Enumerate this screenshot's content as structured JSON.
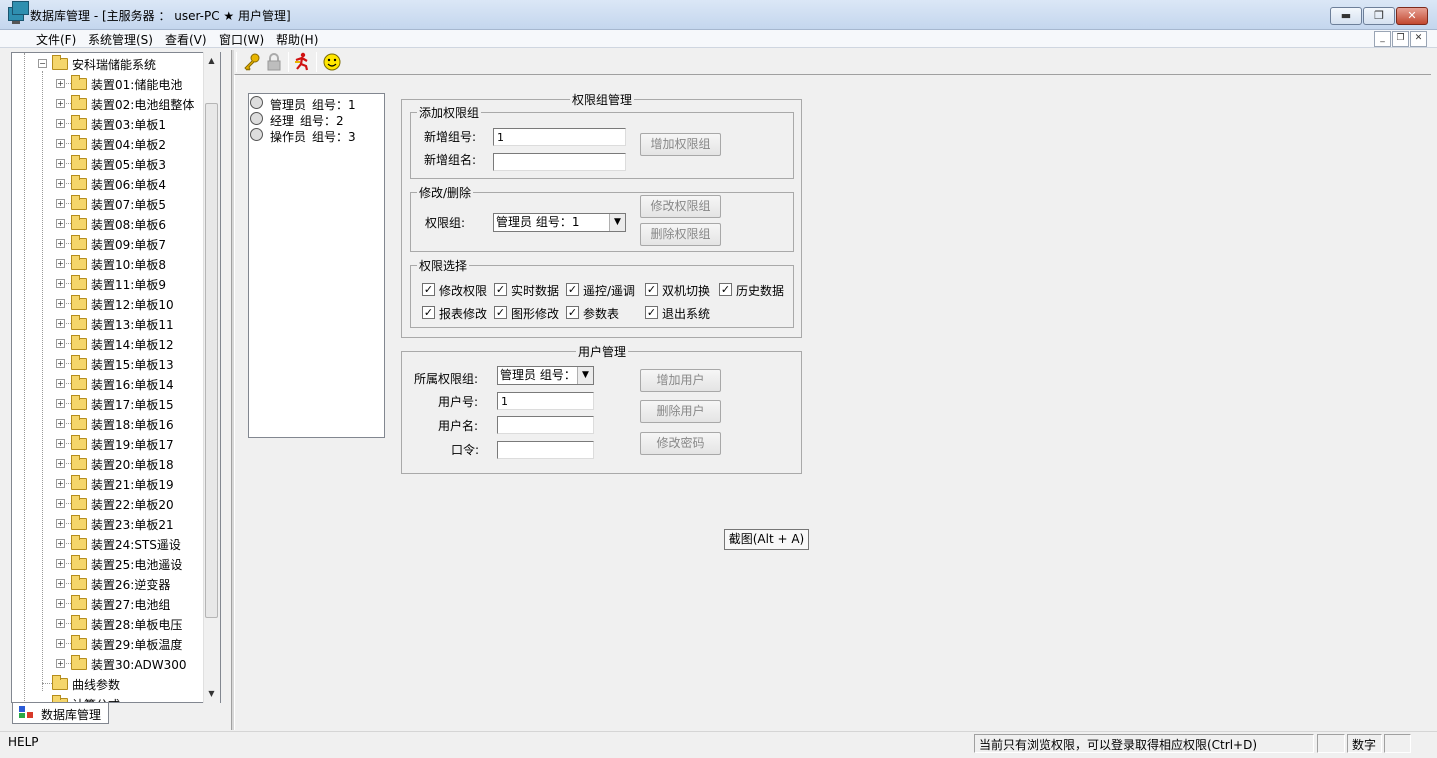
{
  "window": {
    "title": "数据库管理 - [主服务器 ： user-PC ★ 用户管理]",
    "minimize": "▬",
    "restore": "❐",
    "close": "✕"
  },
  "menu": {
    "items": [
      "文件(F)",
      "系统管理(S)",
      "查看(V)",
      "窗口(W)",
      "帮助(H)"
    ],
    "mdi_min": "_",
    "mdi_restore": "❐",
    "mdi_close": "✕"
  },
  "tree": {
    "root": "安科瑞储能系统",
    "devices": [
      "装置01:储能电池",
      "装置02:电池组整体",
      "装置03:单板1",
      "装置04:单板2",
      "装置05:单板3",
      "装置06:单板4",
      "装置07:单板5",
      "装置08:单板6",
      "装置09:单板7",
      "装置10:单板8",
      "装置11:单板9",
      "装置12:单板10",
      "装置13:单板11",
      "装置14:单板12",
      "装置15:单板13",
      "装置16:单板14",
      "装置17:单板15",
      "装置18:单板16",
      "装置19:单板17",
      "装置20:单板18",
      "装置21:单板19",
      "装置22:单板20",
      "装置23:单板21",
      "装置24:STS遥设",
      "装置25:电池遥设",
      "装置26:逆变器",
      "装置27:电池组",
      "装置28:单板电压",
      "装置29:单板温度",
      "装置30:ADW300"
    ],
    "curve_params": "曲线参数",
    "formula": "计算公式",
    "bottom_tab": "数据库管理"
  },
  "group_list": [
    {
      "role": "管理员",
      "label": "组号：1"
    },
    {
      "role": "经理",
      "label": "组号：2"
    },
    {
      "role": "操作员",
      "label": "组号：3"
    }
  ],
  "perm_group": {
    "title": "权限组管理",
    "add": {
      "legend": "添加权限组",
      "new_no_label": "新增组号:",
      "new_no_value": "1",
      "new_name_label": "新增组名:",
      "new_name_value": "",
      "add_button": "增加权限组"
    },
    "edit": {
      "legend": "修改/删除",
      "group_label": "权限组:",
      "group_value": "管理员  组号：1",
      "modify_button": "修改权限组",
      "delete_button": "删除权限组"
    },
    "select": {
      "legend": "权限选择",
      "options": [
        {
          "label": "修改权限",
          "checked": true
        },
        {
          "label": "实时数据",
          "checked": true
        },
        {
          "label": "遥控/遥调",
          "checked": true
        },
        {
          "label": "双机切换",
          "checked": true
        },
        {
          "label": "历史数据",
          "checked": true
        },
        {
          "label": "报表修改",
          "checked": true
        },
        {
          "label": "图形修改",
          "checked": true
        },
        {
          "label": "参数表",
          "checked": true
        },
        {
          "label": "退出系统",
          "checked": true
        }
      ]
    }
  },
  "user_mgmt": {
    "title": "用户管理",
    "group_label": "所属权限组:",
    "group_value": "管理员  组号：",
    "user_no_label": "用户号:",
    "user_no_value": "1",
    "user_name_label": "用户名:",
    "user_name_value": "",
    "password_label": "口令:",
    "password_value": "",
    "add_user_button": "增加用户",
    "delete_user_button": "删除用户",
    "change_password_button": "修改密码"
  },
  "tooltip": "截图(Alt + A)",
  "status": {
    "help": "HELP",
    "message": "当前只有浏览权限，可以登录取得相应权限(Ctrl+D)",
    "num": "数字"
  },
  "colors": {
    "titlebar": "#c4d6ee",
    "close_button": "#c24830",
    "folder": "#f5d66b"
  }
}
